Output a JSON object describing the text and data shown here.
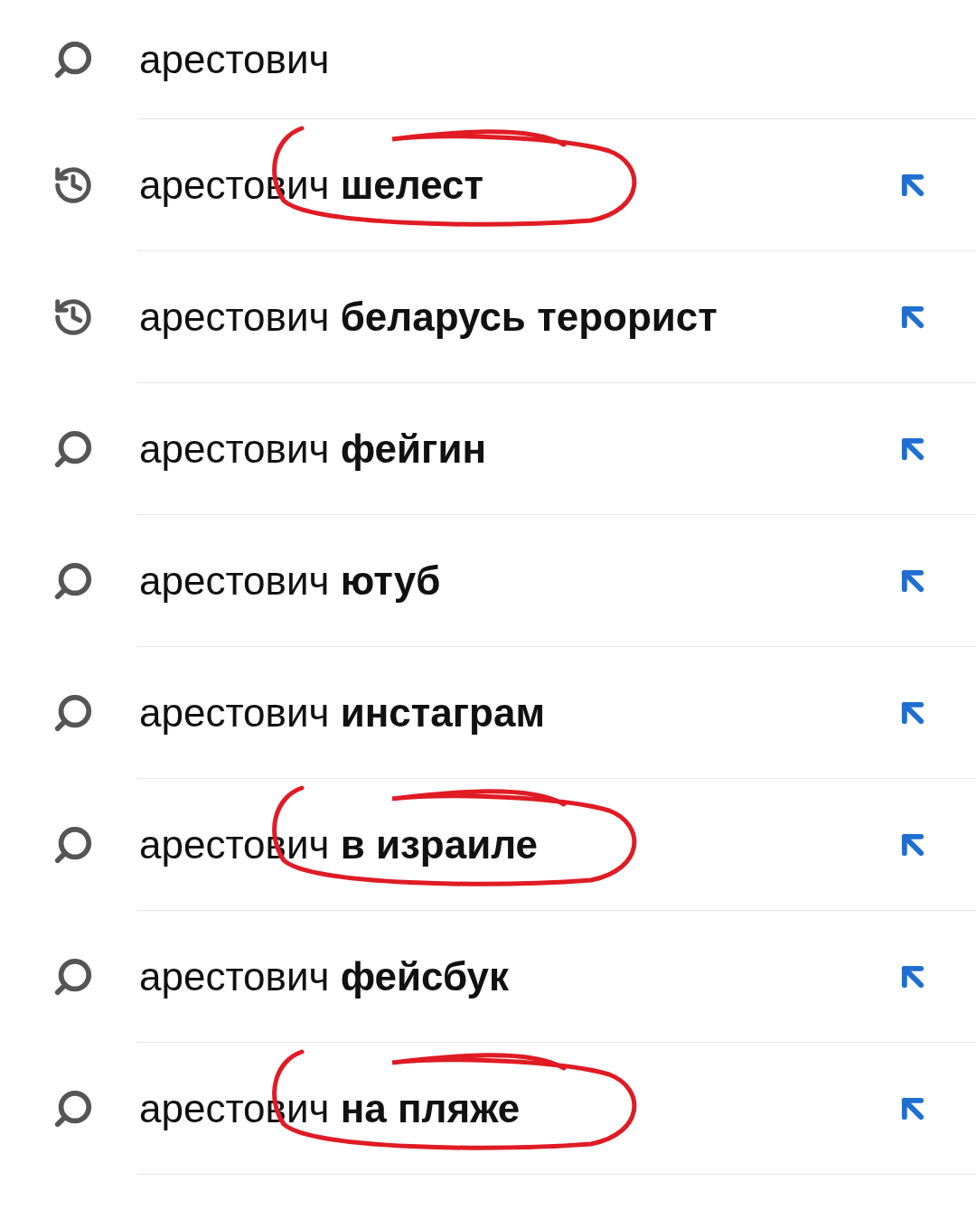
{
  "query": {
    "text": "арестович"
  },
  "suggestions": [
    {
      "kind": "history",
      "text": "арестович **шелест**",
      "circled": true
    },
    {
      "kind": "history",
      "text": "арестович **беларусь терорист**",
      "circled": false
    },
    {
      "kind": "search",
      "text": "арестович **фейгин**",
      "circled": false
    },
    {
      "kind": "search",
      "text": "арестович **ютуб**",
      "circled": false
    },
    {
      "kind": "search",
      "text": "арестович **инстаграм**",
      "circled": false
    },
    {
      "kind": "search",
      "text": "арестович **в израиле**",
      "circled": true
    },
    {
      "kind": "search",
      "text": "арестович **фейсбук**",
      "circled": false
    },
    {
      "kind": "search",
      "text": "арестович **на пляже**",
      "circled": true
    }
  ]
}
